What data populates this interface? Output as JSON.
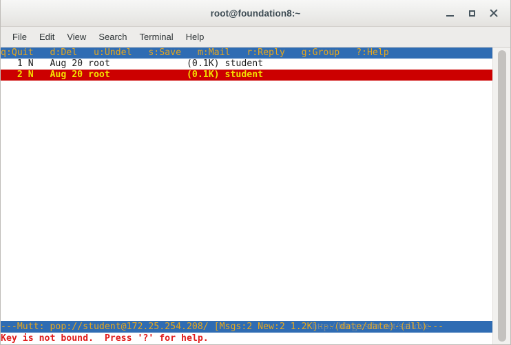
{
  "window": {
    "title": "root@foundation8:~",
    "buttons": {
      "minimize": "minimize",
      "maximize": "maximize",
      "close": "close"
    }
  },
  "menubar": {
    "items": [
      {
        "label": "File"
      },
      {
        "label": "Edit"
      },
      {
        "label": "View"
      },
      {
        "label": "Search"
      },
      {
        "label": "Terminal"
      },
      {
        "label": "Help"
      }
    ]
  },
  "terminal": {
    "help_bar": "q:Quit   d:Del   u:Undel   s:Save   m:Mail   r:Reply   g:Group   ?:Help",
    "messages": [
      {
        "index": "1",
        "flag": "N",
        "date": "Aug 20",
        "sender": "root",
        "size": "(0.1K)",
        "subject": "student",
        "selected": false,
        "line": "   1 N   Aug 20 root              (0.1K) student"
      },
      {
        "index": "2",
        "flag": "N",
        "date": "Aug 20",
        "sender": "root",
        "size": "(0.1K)",
        "subject": "student",
        "selected": true,
        "line": "   2 N   Aug 20 root              (0.1K) student"
      }
    ],
    "status_line": "---Mutt: pop://student@172.25.254.208/ [Msgs:2 New:2 1.2K]---(date/date)-(all)---",
    "error_line": "Key is not bound.  Press '?' for help.",
    "watermark": "http://blog.csdn.net/sallove"
  },
  "colors": {
    "bar_blue_bg": "#2f6cb3",
    "bar_amber_fg": "#e8a81c",
    "selected_bg": "#cc0000",
    "selected_fg": "#f3e000",
    "error_fg": "#e01b1b",
    "terminal_bg": "#ffffff",
    "terminal_fg": "#1a1a1a"
  }
}
